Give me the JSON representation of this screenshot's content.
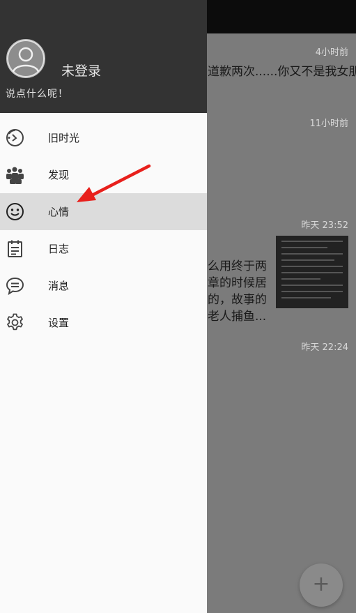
{
  "feed": {
    "items": [
      {
        "time": "4小时前",
        "lines": [
          "道歉两次......你又不是我女朋"
        ]
      },
      {
        "time": "11小时前",
        "lines": []
      },
      {
        "time": "昨天 23:52",
        "lines": [
          "么用终于两",
          "章的时候居",
          "的，故事的",
          "老人捕鱼..."
        ]
      },
      {
        "time": "昨天 22:24",
        "lines": []
      }
    ],
    "fab_label": "+"
  },
  "drawer": {
    "header": {
      "login_status": "未登录",
      "motto": "说点什么呢！"
    },
    "menu": [
      {
        "label": "旧时光",
        "icon": "history-clock-icon"
      },
      {
        "label": "发现",
        "icon": "people-group-icon"
      },
      {
        "label": "心情",
        "icon": "smiley-face-icon",
        "active": true
      },
      {
        "label": "日志",
        "icon": "notepad-icon"
      },
      {
        "label": "消息",
        "icon": "chat-bubble-icon"
      },
      {
        "label": "设置",
        "icon": "gear-icon"
      }
    ]
  },
  "colors": {
    "drawer_header": "#333333",
    "drawer_body": "#fafafa",
    "active_item": "#dcdcdc",
    "annotation_arrow": "#e8201c",
    "scrim": "#7b7b7b"
  }
}
